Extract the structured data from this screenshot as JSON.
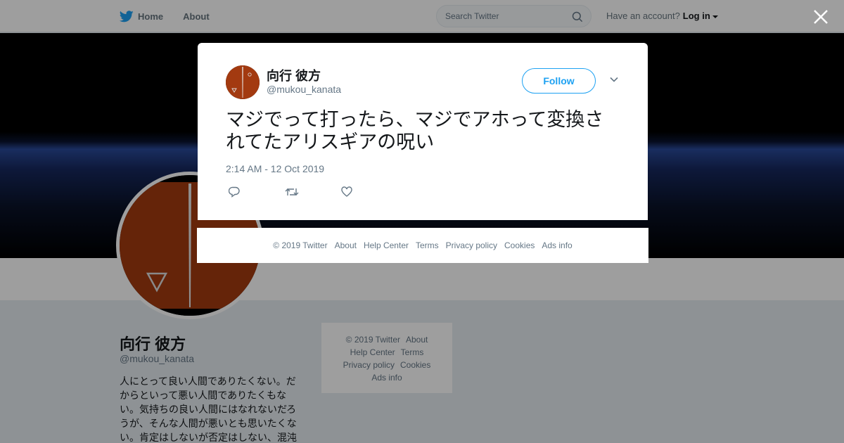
{
  "nav": {
    "home": "Home",
    "about": "About",
    "search_placeholder": "Search Twitter",
    "have_account": "Have an account?",
    "login": "Log in"
  },
  "profile": {
    "name": "向行 彼方",
    "handle": "@mukou_kanata",
    "bio": "人にとって良い人間でありたくない。だからといって悪い人間でありたくもない。気持ちの良い人間にはなれないだろうが、そんな人間が悪いとも思いたくない。肯定はしないが否定はしない、混沌"
  },
  "side_footer": {
    "copyright": "© 2019 Twitter",
    "about": "About",
    "help": "Help Center",
    "terms": "Terms",
    "privacy": "Privacy policy",
    "cookies": "Cookies",
    "ads": "Ads info"
  },
  "tweet": {
    "name": "向行 彼方",
    "handle": "@mukou_kanata",
    "follow": "Follow",
    "text": "マジでって打ったら、マジでアホって変換されてたアリスギアの呪い",
    "time": "2:14 AM - 12 Oct 2019"
  },
  "modal_footer": {
    "copyright": "© 2019 Twitter",
    "about": "About",
    "help": "Help Center",
    "terms": "Terms",
    "privacy": "Privacy policy",
    "cookies": "Cookies",
    "ads": "Ads info"
  },
  "colors": {
    "accent": "#1da1f2",
    "avatar_bg": "#a33a10"
  }
}
